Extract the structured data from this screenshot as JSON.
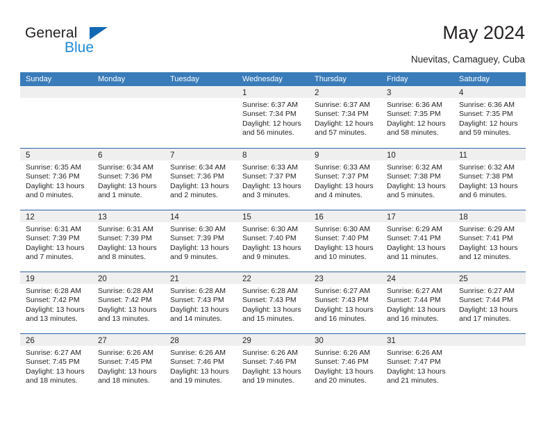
{
  "brand": {
    "name_part1": "General",
    "name_part2": "Blue",
    "triangle_color": "#1268b3",
    "blue_color": "#1f8ad6"
  },
  "header": {
    "title": "May 2024",
    "location": "Nuevitas, Camaguey, Cuba"
  },
  "theme": {
    "header_blue": "#3a7cb9",
    "row_border_blue": "#2c63a0",
    "daynum_band": "#efefef",
    "text": "#231f20"
  },
  "calendar": {
    "weekday_headers": [
      "Sunday",
      "Monday",
      "Tuesday",
      "Wednesday",
      "Thursday",
      "Friday",
      "Saturday"
    ],
    "weeks": [
      [
        {
          "day": "",
          "sunrise": "",
          "sunset": "",
          "daylight1": "",
          "daylight2": ""
        },
        {
          "day": "",
          "sunrise": "",
          "sunset": "",
          "daylight1": "",
          "daylight2": ""
        },
        {
          "day": "",
          "sunrise": "",
          "sunset": "",
          "daylight1": "",
          "daylight2": ""
        },
        {
          "day": "1",
          "sunrise": "Sunrise: 6:37 AM",
          "sunset": "Sunset: 7:34 PM",
          "daylight1": "Daylight: 12 hours",
          "daylight2": "and 56 minutes."
        },
        {
          "day": "2",
          "sunrise": "Sunrise: 6:37 AM",
          "sunset": "Sunset: 7:34 PM",
          "daylight1": "Daylight: 12 hours",
          "daylight2": "and 57 minutes."
        },
        {
          "day": "3",
          "sunrise": "Sunrise: 6:36 AM",
          "sunset": "Sunset: 7:35 PM",
          "daylight1": "Daylight: 12 hours",
          "daylight2": "and 58 minutes."
        },
        {
          "day": "4",
          "sunrise": "Sunrise: 6:36 AM",
          "sunset": "Sunset: 7:35 PM",
          "daylight1": "Daylight: 12 hours",
          "daylight2": "and 59 minutes."
        }
      ],
      [
        {
          "day": "5",
          "sunrise": "Sunrise: 6:35 AM",
          "sunset": "Sunset: 7:36 PM",
          "daylight1": "Daylight: 13 hours",
          "daylight2": "and 0 minutes."
        },
        {
          "day": "6",
          "sunrise": "Sunrise: 6:34 AM",
          "sunset": "Sunset: 7:36 PM",
          "daylight1": "Daylight: 13 hours",
          "daylight2": "and 1 minute."
        },
        {
          "day": "7",
          "sunrise": "Sunrise: 6:34 AM",
          "sunset": "Sunset: 7:36 PM",
          "daylight1": "Daylight: 13 hours",
          "daylight2": "and 2 minutes."
        },
        {
          "day": "8",
          "sunrise": "Sunrise: 6:33 AM",
          "sunset": "Sunset: 7:37 PM",
          "daylight1": "Daylight: 13 hours",
          "daylight2": "and 3 minutes."
        },
        {
          "day": "9",
          "sunrise": "Sunrise: 6:33 AM",
          "sunset": "Sunset: 7:37 PM",
          "daylight1": "Daylight: 13 hours",
          "daylight2": "and 4 minutes."
        },
        {
          "day": "10",
          "sunrise": "Sunrise: 6:32 AM",
          "sunset": "Sunset: 7:38 PM",
          "daylight1": "Daylight: 13 hours",
          "daylight2": "and 5 minutes."
        },
        {
          "day": "11",
          "sunrise": "Sunrise: 6:32 AM",
          "sunset": "Sunset: 7:38 PM",
          "daylight1": "Daylight: 13 hours",
          "daylight2": "and 6 minutes."
        }
      ],
      [
        {
          "day": "12",
          "sunrise": "Sunrise: 6:31 AM",
          "sunset": "Sunset: 7:39 PM",
          "daylight1": "Daylight: 13 hours",
          "daylight2": "and 7 minutes."
        },
        {
          "day": "13",
          "sunrise": "Sunrise: 6:31 AM",
          "sunset": "Sunset: 7:39 PM",
          "daylight1": "Daylight: 13 hours",
          "daylight2": "and 8 minutes."
        },
        {
          "day": "14",
          "sunrise": "Sunrise: 6:30 AM",
          "sunset": "Sunset: 7:39 PM",
          "daylight1": "Daylight: 13 hours",
          "daylight2": "and 9 minutes."
        },
        {
          "day": "15",
          "sunrise": "Sunrise: 6:30 AM",
          "sunset": "Sunset: 7:40 PM",
          "daylight1": "Daylight: 13 hours",
          "daylight2": "and 9 minutes."
        },
        {
          "day": "16",
          "sunrise": "Sunrise: 6:30 AM",
          "sunset": "Sunset: 7:40 PM",
          "daylight1": "Daylight: 13 hours",
          "daylight2": "and 10 minutes."
        },
        {
          "day": "17",
          "sunrise": "Sunrise: 6:29 AM",
          "sunset": "Sunset: 7:41 PM",
          "daylight1": "Daylight: 13 hours",
          "daylight2": "and 11 minutes."
        },
        {
          "day": "18",
          "sunrise": "Sunrise: 6:29 AM",
          "sunset": "Sunset: 7:41 PM",
          "daylight1": "Daylight: 13 hours",
          "daylight2": "and 12 minutes."
        }
      ],
      [
        {
          "day": "19",
          "sunrise": "Sunrise: 6:28 AM",
          "sunset": "Sunset: 7:42 PM",
          "daylight1": "Daylight: 13 hours",
          "daylight2": "and 13 minutes."
        },
        {
          "day": "20",
          "sunrise": "Sunrise: 6:28 AM",
          "sunset": "Sunset: 7:42 PM",
          "daylight1": "Daylight: 13 hours",
          "daylight2": "and 13 minutes."
        },
        {
          "day": "21",
          "sunrise": "Sunrise: 6:28 AM",
          "sunset": "Sunset: 7:43 PM",
          "daylight1": "Daylight: 13 hours",
          "daylight2": "and 14 minutes."
        },
        {
          "day": "22",
          "sunrise": "Sunrise: 6:28 AM",
          "sunset": "Sunset: 7:43 PM",
          "daylight1": "Daylight: 13 hours",
          "daylight2": "and 15 minutes."
        },
        {
          "day": "23",
          "sunrise": "Sunrise: 6:27 AM",
          "sunset": "Sunset: 7:43 PM",
          "daylight1": "Daylight: 13 hours",
          "daylight2": "and 16 minutes."
        },
        {
          "day": "24",
          "sunrise": "Sunrise: 6:27 AM",
          "sunset": "Sunset: 7:44 PM",
          "daylight1": "Daylight: 13 hours",
          "daylight2": "and 16 minutes."
        },
        {
          "day": "25",
          "sunrise": "Sunrise: 6:27 AM",
          "sunset": "Sunset: 7:44 PM",
          "daylight1": "Daylight: 13 hours",
          "daylight2": "and 17 minutes."
        }
      ],
      [
        {
          "day": "26",
          "sunrise": "Sunrise: 6:27 AM",
          "sunset": "Sunset: 7:45 PM",
          "daylight1": "Daylight: 13 hours",
          "daylight2": "and 18 minutes."
        },
        {
          "day": "27",
          "sunrise": "Sunrise: 6:26 AM",
          "sunset": "Sunset: 7:45 PM",
          "daylight1": "Daylight: 13 hours",
          "daylight2": "and 18 minutes."
        },
        {
          "day": "28",
          "sunrise": "Sunrise: 6:26 AM",
          "sunset": "Sunset: 7:46 PM",
          "daylight1": "Daylight: 13 hours",
          "daylight2": "and 19 minutes."
        },
        {
          "day": "29",
          "sunrise": "Sunrise: 6:26 AM",
          "sunset": "Sunset: 7:46 PM",
          "daylight1": "Daylight: 13 hours",
          "daylight2": "and 19 minutes."
        },
        {
          "day": "30",
          "sunrise": "Sunrise: 6:26 AM",
          "sunset": "Sunset: 7:46 PM",
          "daylight1": "Daylight: 13 hours",
          "daylight2": "and 20 minutes."
        },
        {
          "day": "31",
          "sunrise": "Sunrise: 6:26 AM",
          "sunset": "Sunset: 7:47 PM",
          "daylight1": "Daylight: 13 hours",
          "daylight2": "and 21 minutes."
        },
        {
          "day": "",
          "sunrise": "",
          "sunset": "",
          "daylight1": "",
          "daylight2": ""
        }
      ]
    ]
  }
}
